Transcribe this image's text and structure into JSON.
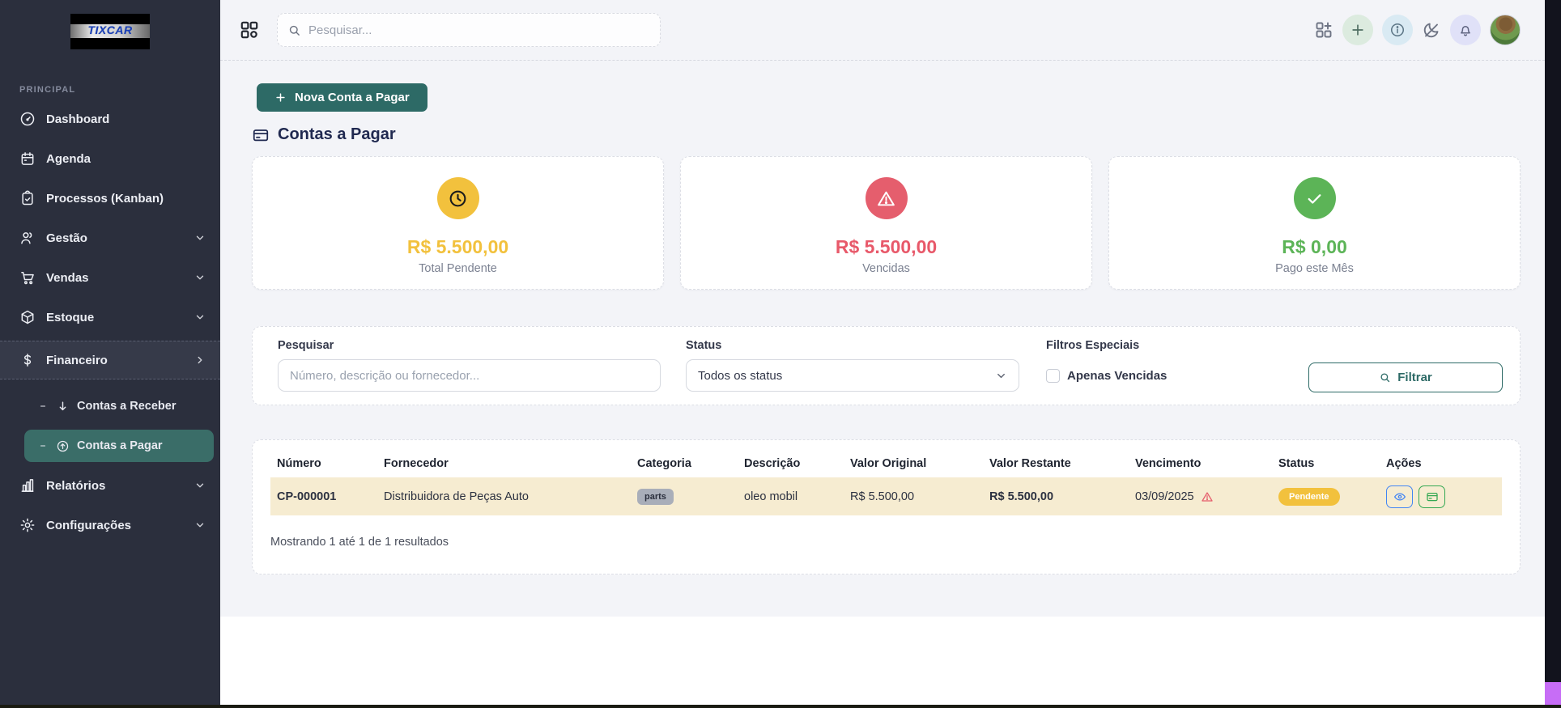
{
  "sidebar": {
    "logo_text": "TIXCAR",
    "section_label": "PRINCIPAL",
    "items": [
      {
        "label": "Dashboard"
      },
      {
        "label": "Agenda"
      },
      {
        "label": "Processos (Kanban)"
      },
      {
        "label": "Gestão"
      },
      {
        "label": "Vendas"
      },
      {
        "label": "Estoque"
      },
      {
        "label": "Financeiro"
      },
      {
        "label": "Relatórios"
      },
      {
        "label": "Configurações"
      }
    ],
    "subitems": [
      {
        "label": "Contas a Receber"
      },
      {
        "label": "Contas a Pagar"
      }
    ]
  },
  "topbar": {
    "search_placeholder": "Pesquisar..."
  },
  "page": {
    "new_button_label": "Nova Conta a Pagar",
    "title": "Contas a Pagar"
  },
  "stats": [
    {
      "value": "R$ 5.500,00",
      "label": "Total Pendente",
      "color": "#f2c13d",
      "icon": "clock"
    },
    {
      "value": "R$ 5.500,00",
      "label": "Vencidas",
      "color": "#e8596a",
      "icon": "warning"
    },
    {
      "value": "R$ 0,00",
      "label": "Pago este Mês",
      "color": "#5cb457",
      "icon": "check"
    }
  ],
  "filters": {
    "search_label": "Pesquisar",
    "search_placeholder": "Número, descrição ou fornecedor...",
    "status_label": "Status",
    "status_value": "Todos os status",
    "special_label": "Filtros Especiais",
    "checkbox_label": "Apenas Vencidas",
    "filter_button_label": "Filtrar"
  },
  "table": {
    "columns": [
      "Número",
      "Fornecedor",
      "Categoria",
      "Descrição",
      "Valor Original",
      "Valor Restante",
      "Vencimento",
      "Status",
      "Ações"
    ],
    "rows": [
      {
        "numero": "CP-000001",
        "fornecedor": "Distribuidora de Peças Auto",
        "categoria": "parts",
        "descricao": "oleo mobil",
        "valor_original": "R$ 5.500,00",
        "valor_restante": "R$ 5.500,00",
        "vencimento": "03/09/2025",
        "status": "Pendente"
      }
    ],
    "footer": "Mostrando 1 até 1 de 1 resultados"
  },
  "colors": {
    "sidebar_bg": "#2b2f3d",
    "accent_teal": "#2d6a66",
    "active_submenu": "#3a6d68",
    "pending_yellow": "#f2c13d",
    "overdue_red": "#e8596a",
    "paid_green": "#5cb457",
    "row_highlight": "#f6ecd1",
    "page_bg": "#f3f4f8"
  }
}
